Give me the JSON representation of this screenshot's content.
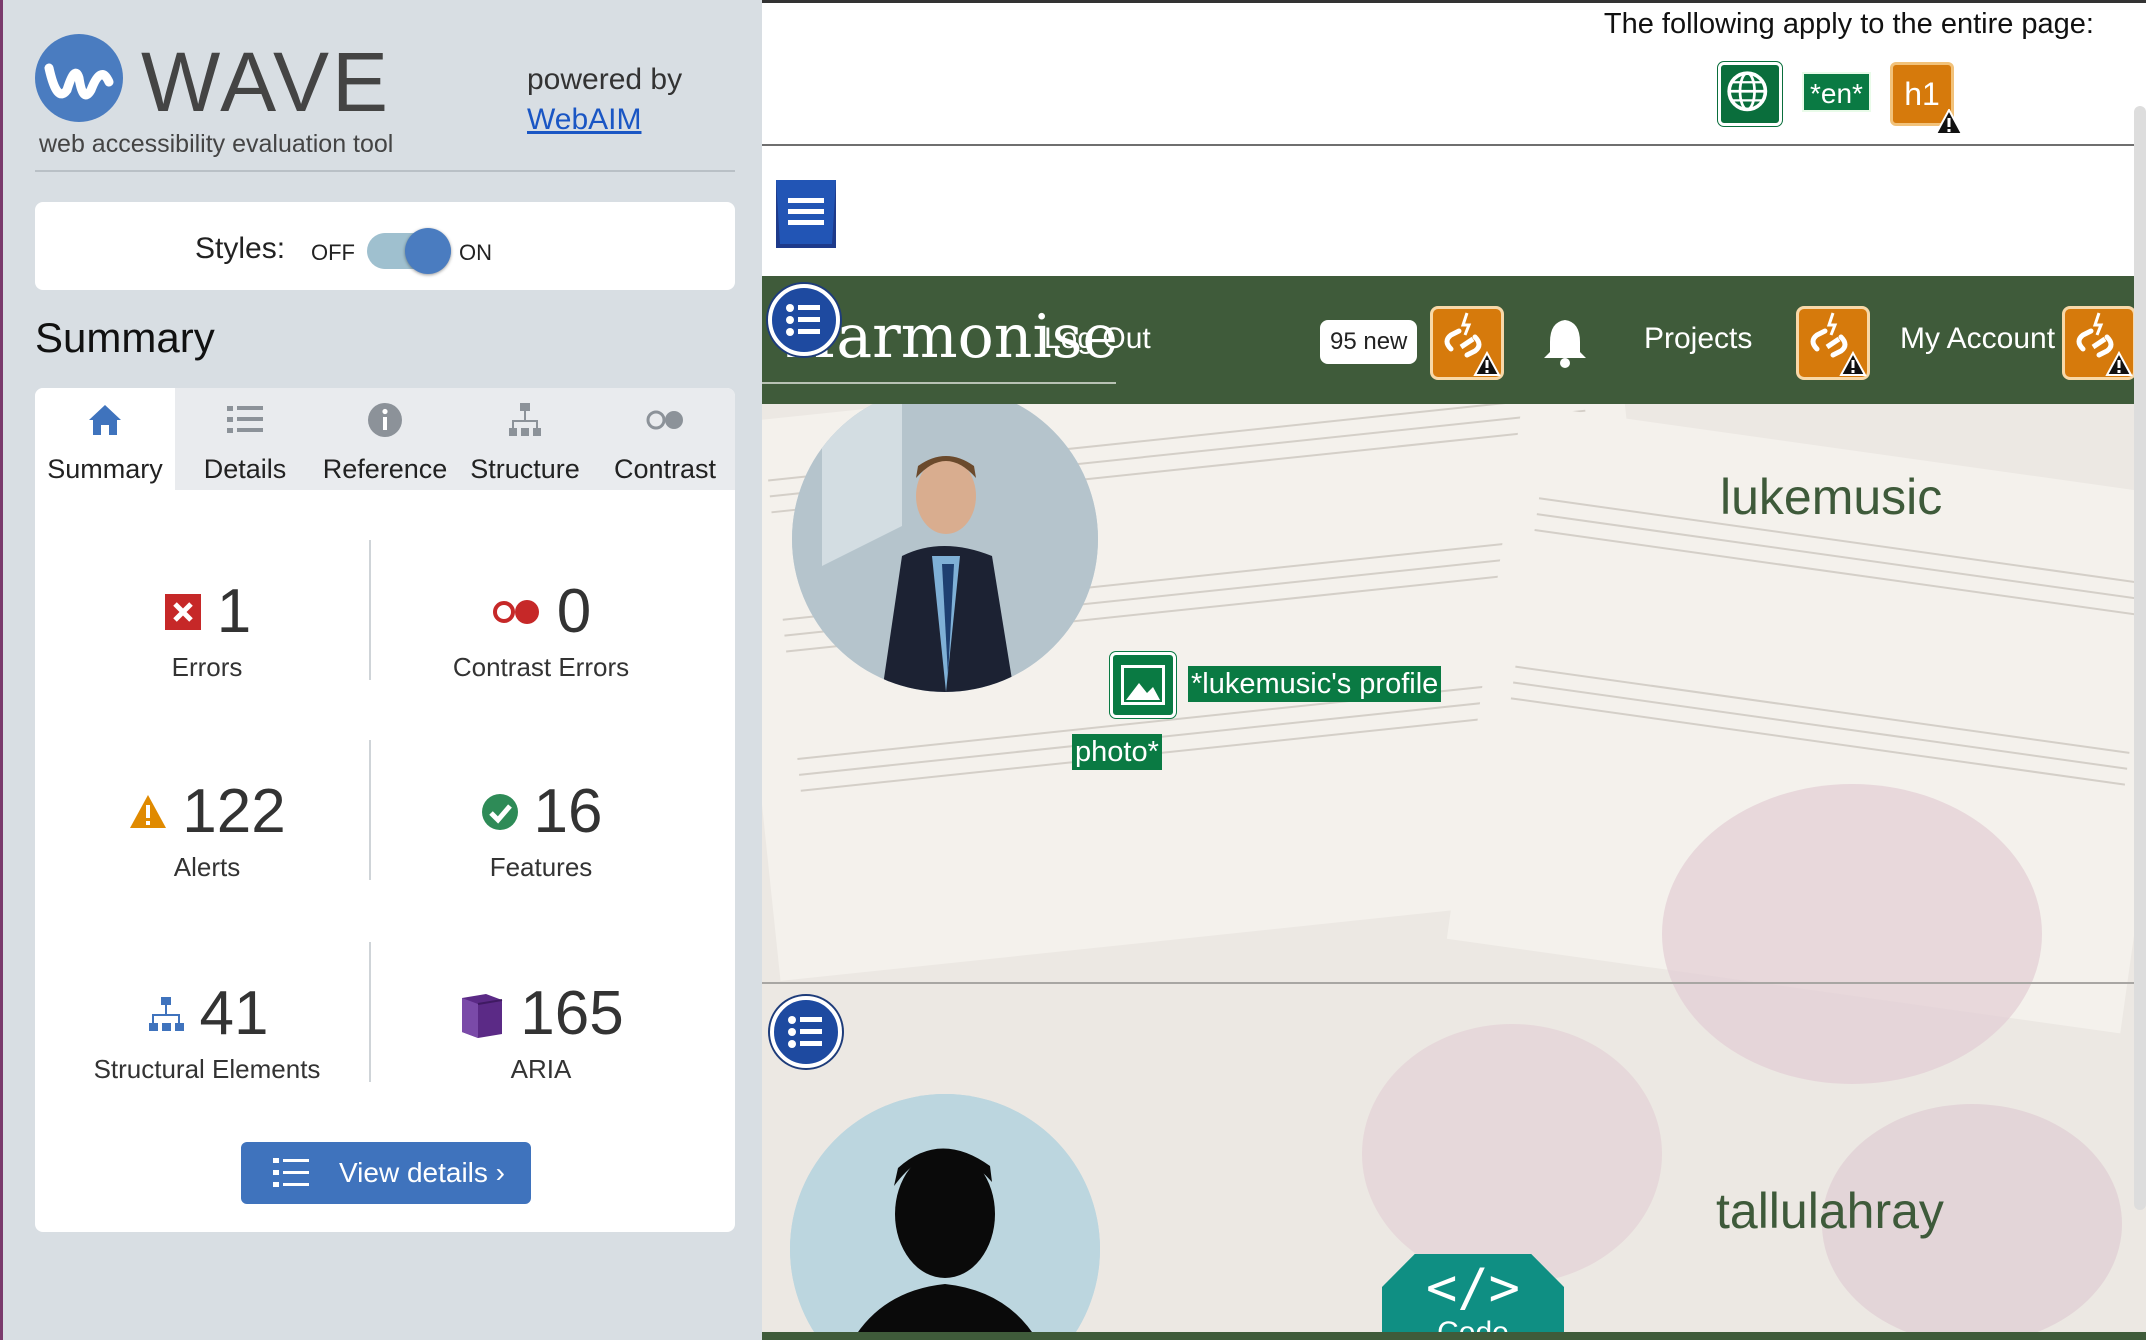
{
  "wave": {
    "title": "WAVE",
    "subtitle": "web accessibility evaluation tool",
    "powered_by": "powered by",
    "webaim_link": "WebAIM",
    "styles_label": "Styles:",
    "toggle_off": "OFF",
    "toggle_on": "ON",
    "styles_state": "on",
    "summary_heading": "Summary",
    "tabs": [
      {
        "label": "Summary",
        "icon": "home-icon",
        "active": true
      },
      {
        "label": "Details",
        "icon": "list-icon",
        "active": false
      },
      {
        "label": "Reference",
        "icon": "info-icon",
        "active": false
      },
      {
        "label": "Structure",
        "icon": "hierarchy-icon",
        "active": false
      },
      {
        "label": "Contrast",
        "icon": "contrast-icon",
        "active": false
      }
    ],
    "stats": {
      "errors": {
        "value": "1",
        "label": "Errors",
        "icon": "error-icon",
        "color": "#c62828"
      },
      "contrast_errors": {
        "value": "0",
        "label": "Contrast Errors",
        "icon": "contrast-error-icon",
        "color": "#c62828"
      },
      "alerts": {
        "value": "122",
        "label": "Alerts",
        "icon": "alert-icon",
        "color": "#e08a00"
      },
      "features": {
        "value": "16",
        "label": "Features",
        "icon": "feature-icon",
        "color": "#2e8b57"
      },
      "structural": {
        "value": "41",
        "label": "Structural Elements",
        "icon": "structure-icon",
        "color": "#3f73bd"
      },
      "aria": {
        "value": "165",
        "label": "ARIA",
        "icon": "aria-icon",
        "color": "#5b2a86"
      }
    },
    "view_details": "View details ›"
  },
  "page": {
    "notice": "The following apply to the entire page:",
    "lang_label": "*en*",
    "h1_label": "h1",
    "brand": "Harmonise",
    "nav": {
      "logout": "Log Out",
      "notifications_badge": "95 new",
      "projects": "Projects",
      "account": "My Account"
    },
    "profiles": [
      {
        "username": "lukemusic",
        "alt_line1": "*lukemusic's profile",
        "alt_line2": "photo*"
      },
      {
        "username": "tallulahray"
      }
    ],
    "code_button": {
      "glyph": "</>",
      "label": "Code"
    },
    "colors": {
      "nav_green": "#3f5b3a",
      "wave_blue": "#4a7cc0",
      "alert_orange": "#d67a0c",
      "feature_green": "#0a7a43"
    }
  }
}
